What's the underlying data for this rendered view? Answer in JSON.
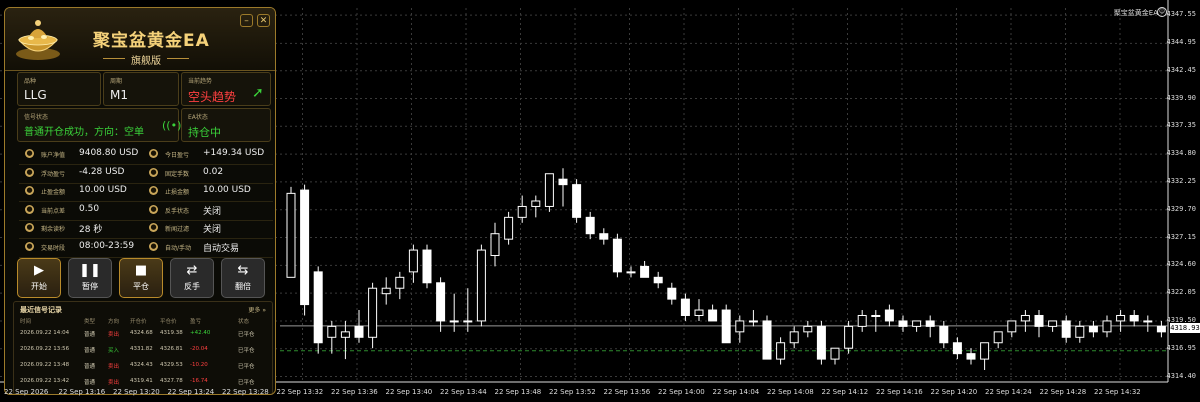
{
  "panel": {
    "title": "聚宝盆黄金EA",
    "subtitle": "旗舰版",
    "fields": {
      "symbol_label": "品种",
      "symbol": "LLG",
      "period_label": "周期",
      "period": "M1",
      "trend_label": "当前趋势",
      "trend": "空头趋势",
      "signal_label": "信号状态",
      "signal": "普通开仓成功，方向：空单",
      "ea_label": "EA状态",
      "ea": "持仓中"
    },
    "stats": [
      {
        "k": "账户净值",
        "v": "9408.80 USD",
        "c": "",
        "k2": "今日盈亏",
        "v2": "+149.34 USD",
        "c2": "green"
      },
      {
        "k": "浮动盈亏",
        "v": "-4.28 USD",
        "c": "red",
        "k2": "固定手数",
        "v2": "0.02",
        "c2": ""
      },
      {
        "k": "止盈金额",
        "v": "10.00 USD",
        "c": "",
        "k2": "止损金额",
        "v2": "10.00 USD",
        "c2": ""
      },
      {
        "k": "当前点差",
        "v": "0.50",
        "c": "",
        "k2": "反手状态",
        "v2": "关闭",
        "c2": ""
      },
      {
        "k": "剩余读秒",
        "v": "28 秒",
        "c": "",
        "k2": "新闻过滤",
        "v2": "关闭",
        "c2": ""
      },
      {
        "k": "交易时段",
        "v": "08:00-23:59",
        "c": "",
        "k2": "自动/手动",
        "v2": "自动交易",
        "c2": "green"
      }
    ],
    "buttons": [
      {
        "label": "开始",
        "glyph": "▶"
      },
      {
        "label": "暂停",
        "glyph": "❚❚"
      },
      {
        "label": "平仓",
        "glyph": "■"
      },
      {
        "label": "反手",
        "glyph": "⇄"
      },
      {
        "label": "翻倍",
        "glyph": "⇆"
      }
    ],
    "history": {
      "title": "最近信号记录",
      "more": "更多 »",
      "headers": [
        "时间",
        "类型",
        "方向",
        "开仓价",
        "平仓价",
        "盈亏",
        "状态"
      ],
      "rows": [
        [
          "2026.09.22 14:04",
          "普通",
          "卖出",
          "4324.68",
          "4319.38",
          "+42.40",
          "已平仓"
        ],
        [
          "2026.09.22 13:56",
          "普通",
          "买入",
          "4331.82",
          "4326.81",
          "-20.04",
          "已平仓"
        ],
        [
          "2026.09.22 13:48",
          "普通",
          "卖出",
          "4324.43",
          "4329.53",
          "-10.20",
          "已平仓"
        ],
        [
          "2026.09.22 13:42",
          "普通",
          "卖出",
          "4319.41",
          "4327.78",
          "-16.74",
          "已平仓"
        ]
      ]
    }
  },
  "chart": {
    "indicator_label": "聚宝盆黄金EA",
    "current_price": "4318.93",
    "price_labels": [
      "4347.55",
      "4344.95",
      "4342.45",
      "4339.90",
      "4337.35",
      "4334.80",
      "4332.25",
      "4329.70",
      "4327.15",
      "4324.60",
      "4322.05",
      "4319.50",
      "4316.95",
      "4314.40"
    ],
    "time_labels": [
      "22 Sep 2026",
      "22 Sep 13:16",
      "22 Sep 13:20",
      "22 Sep 13:24",
      "22 Sep 13:28",
      "22 Sep 13:32",
      "22 Sep 13:36",
      "22 Sep 13:40",
      "22 Sep 13:44",
      "22 Sep 13:48",
      "22 Sep 13:52",
      "22 Sep 13:56",
      "22 Sep 14:00",
      "22 Sep 14:04",
      "22 Sep 14:08",
      "22 Sep 14:12",
      "22 Sep 14:16",
      "22 Sep 14:20",
      "22 Sep 14:24",
      "22 Sep 14:28",
      "22 Sep 14:32"
    ],
    "candles": [
      [
        4323.5,
        4331.8,
        4325.0,
        4331.2
      ],
      [
        4331.5,
        4332.0,
        4320.0,
        4321.0
      ],
      [
        4324.0,
        4324.5,
        4316.5,
        4317.5
      ],
      [
        4318.0,
        4319.5,
        4316.5,
        4319.0
      ],
      [
        4318.0,
        4319.5,
        4316.0,
        4318.5
      ],
      [
        4319.0,
        4320.5,
        4317.5,
        4318.0
      ],
      [
        4318.0,
        4323.0,
        4317.0,
        4322.5
      ],
      [
        4322.0,
        4323.5,
        4321.0,
        4322.5
      ],
      [
        4322.5,
        4324.0,
        4321.5,
        4323.5
      ],
      [
        4324.0,
        4326.5,
        4323.0,
        4326.0
      ],
      [
        4326.0,
        4326.5,
        4322.5,
        4323.0
      ],
      [
        4323.0,
        4323.5,
        4318.5,
        4319.5
      ],
      [
        4319.5,
        4322.0,
        4318.5,
        4319.5
      ],
      [
        4319.5,
        4322.5,
        4318.5,
        4319.5
      ],
      [
        4319.5,
        4326.5,
        4319.0,
        4326.0
      ],
      [
        4325.5,
        4328.5,
        4324.5,
        4327.5
      ],
      [
        4327.0,
        4329.5,
        4326.5,
        4329.0
      ],
      [
        4329.0,
        4331.0,
        4328.5,
        4330.0
      ],
      [
        4330.0,
        4331.0,
        4329.0,
        4330.5
      ],
      [
        4330.0,
        4332.5,
        4329.5,
        4333.0
      ],
      [
        4332.5,
        4333.5,
        4330.0,
        4332.0
      ],
      [
        4332.0,
        4332.5,
        4328.5,
        4329.0
      ],
      [
        4329.0,
        4329.5,
        4327.0,
        4327.5
      ],
      [
        4327.5,
        4328.0,
        4326.5,
        4327.0
      ],
      [
        4327.0,
        4327.5,
        4323.5,
        4324.0
      ],
      [
        4324.0,
        4324.5,
        4323.5,
        4324.0
      ],
      [
        4324.5,
        4325.0,
        4323.5,
        4323.5
      ],
      [
        4323.5,
        4324.0,
        4322.5,
        4323.0
      ],
      [
        4322.5,
        4323.0,
        4321.0,
        4321.5
      ],
      [
        4321.5,
        4322.0,
        4319.5,
        4320.0
      ],
      [
        4320.0,
        4321.5,
        4319.5,
        4320.5
      ],
      [
        4320.5,
        4321.0,
        4319.5,
        4319.5
      ],
      [
        4320.5,
        4321.0,
        4317.5,
        4317.5
      ],
      [
        4318.5,
        4320.0,
        4317.5,
        4319.5
      ],
      [
        4319.5,
        4320.5,
        4319.0,
        4319.5
      ],
      [
        4319.5,
        4320.0,
        4316.0,
        4316.0
      ],
      [
        4316.0,
        4318.0,
        4315.5,
        4317.5
      ],
      [
        4317.5,
        4319.0,
        4317.0,
        4318.5
      ],
      [
        4318.5,
        4319.5,
        4318.0,
        4319.0
      ],
      [
        4319.0,
        4319.5,
        4315.5,
        4316.0
      ],
      [
        4316.0,
        4317.0,
        4315.5,
        4317.0
      ],
      [
        4317.0,
        4319.5,
        4316.5,
        4319.0
      ],
      [
        4319.0,
        4320.5,
        4318.5,
        4320.0
      ],
      [
        4320.0,
        4320.5,
        4318.5,
        4320.0
      ],
      [
        4320.5,
        4321.0,
        4319.0,
        4319.5
      ],
      [
        4319.5,
        4320.0,
        4318.5,
        4319.0
      ],
      [
        4319.0,
        4319.5,
        4318.5,
        4319.5
      ],
      [
        4319.5,
        4320.0,
        4318.0,
        4319.0
      ],
      [
        4319.0,
        4319.5,
        4317.0,
        4317.5
      ],
      [
        4317.5,
        4318.0,
        4316.0,
        4316.5
      ],
      [
        4316.5,
        4317.0,
        4315.5,
        4316.0
      ],
      [
        4316.0,
        4317.5,
        4315.0,
        4317.5
      ],
      [
        4317.5,
        4318.5,
        4317.0,
        4318.5
      ],
      [
        4318.5,
        4319.5,
        4318.0,
        4319.5
      ],
      [
        4319.5,
        4320.5,
        4318.5,
        4320.0
      ],
      [
        4320.0,
        4320.5,
        4318.0,
        4319.0
      ],
      [
        4319.0,
        4319.5,
        4318.5,
        4319.5
      ],
      [
        4319.5,
        4320.0,
        4317.5,
        4318.0
      ],
      [
        4318.0,
        4319.5,
        4317.5,
        4319.0
      ],
      [
        4319.0,
        4319.5,
        4318.0,
        4318.5
      ],
      [
        4318.5,
        4320.0,
        4318.0,
        4319.5
      ],
      [
        4319.5,
        4320.5,
        4318.5,
        4320.0
      ],
      [
        4320.0,
        4320.5,
        4319.0,
        4319.5
      ],
      [
        4319.5,
        4320.0,
        4318.5,
        4319.5
      ],
      [
        4319.0,
        4319.5,
        4318.0,
        4318.5
      ]
    ]
  }
}
